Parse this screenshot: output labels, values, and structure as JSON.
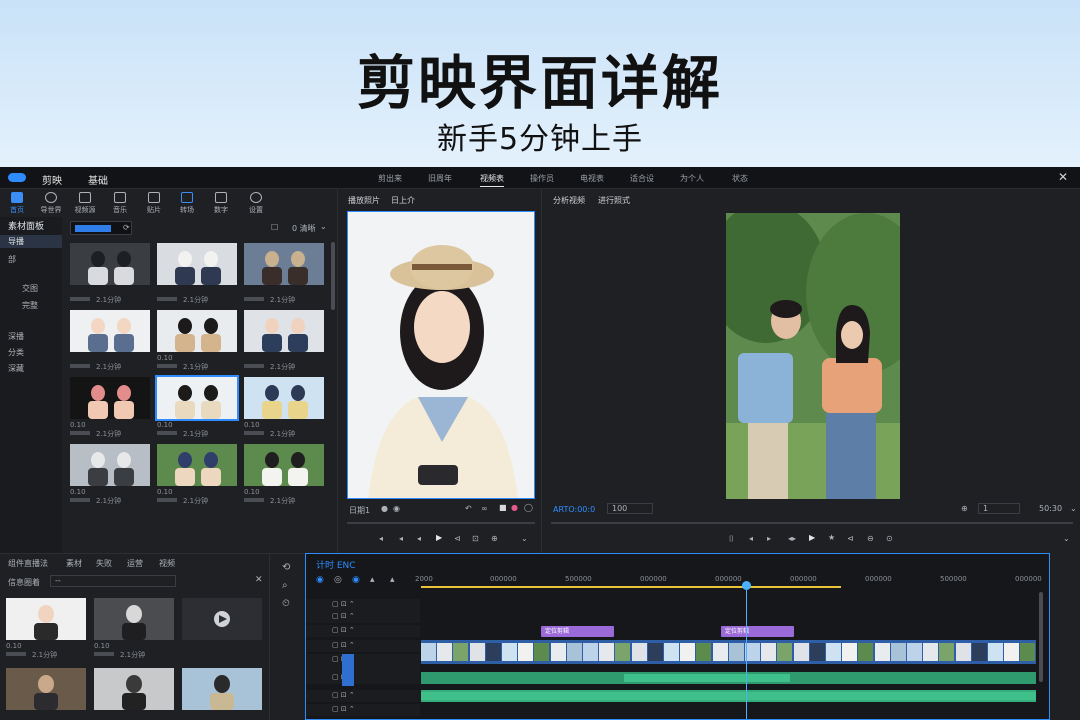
{
  "banner": {
    "title": "剪映界面详解",
    "subtitle": "新手5分钟上手"
  },
  "titlebar": {
    "app_name": "剪映",
    "mode": "基础",
    "menus": [
      "剪出来",
      "旧周年",
      "视频表",
      "操作员",
      "电视表",
      "适合设",
      "为个人",
      "状态"
    ],
    "close": "✕"
  },
  "toolbar": [
    {
      "label": "首页",
      "icon": "home-icon"
    },
    {
      "label": "导世界",
      "icon": "media-icon"
    },
    {
      "label": "视频源",
      "icon": "audio-icon"
    },
    {
      "label": "音乐",
      "icon": "text-icon"
    },
    {
      "label": "贴片",
      "icon": "sticker-icon"
    },
    {
      "label": "转场",
      "icon": "effect-icon"
    },
    {
      "label": "数字",
      "icon": "transition-icon"
    },
    {
      "label": "设置",
      "icon": "settings-icon"
    }
  ],
  "categories": {
    "header": "素材面板",
    "items": [
      "导播",
      "部",
      "交图",
      "完整",
      "深播",
      "分类",
      "深藏"
    ]
  },
  "library": {
    "sort_label": "0 清晰",
    "items": [
      {
        "name": "",
        "duration": "2.1分钟"
      },
      {
        "name": "",
        "duration": "2.1分钟"
      },
      {
        "name": "",
        "duration": "2.1分钟"
      },
      {
        "name": "",
        "duration": "2.1分钟"
      },
      {
        "name": "0.10",
        "duration": "2.1分钟"
      },
      {
        "name": "",
        "duration": "2.1分钟"
      },
      {
        "name": "0.10",
        "duration": "2.1分钟"
      },
      {
        "name": "0.10",
        "duration": "2.1分钟"
      },
      {
        "name": "0.10",
        "duration": "2.1分钟"
      },
      {
        "name": "0.10",
        "duration": "2.1分钟"
      },
      {
        "name": "0.10",
        "duration": "2.1分钟"
      },
      {
        "name": "0.10",
        "duration": "2.1分钟"
      }
    ],
    "selected_index": 7
  },
  "player_left": {
    "tabs": [
      "播放照片",
      "日上介"
    ],
    "label": "日期1"
  },
  "player_right": {
    "tabs": [
      "分析视频",
      "进行照式"
    ],
    "timecode": "ARTO:00:0",
    "resolution": "100",
    "zoom_right": "50:30",
    "zoom_value": "1"
  },
  "bottom_left": {
    "tabs": [
      "组件直播法",
      "素材",
      "失败",
      "运营",
      "视频"
    ],
    "filter_label": "信息圈着",
    "filter_value": "--",
    "items": [
      {
        "name": "0.10",
        "duration": "2.1分钟"
      },
      {
        "name": "0.10",
        "duration": "2.1分钟"
      },
      {
        "name": "",
        "duration": ""
      },
      {
        "name": "",
        "duration": ""
      },
      {
        "name": "",
        "duration": ""
      },
      {
        "name": "",
        "duration": ""
      }
    ]
  },
  "timeline": {
    "label": "计时 ENC",
    "ticks": [
      "2000",
      "000000",
      "500000",
      "000000",
      "000000",
      "000000",
      "000000",
      "500000",
      "000000"
    ],
    "clip_labels": [
      "定位剪辑",
      "定位剪辑"
    ],
    "playhead_fraction": 0.57
  },
  "colors": {
    "accent": "#2f8cff",
    "clip_purple": "#9b6ad8",
    "audio_green": "#3fbf8a"
  }
}
